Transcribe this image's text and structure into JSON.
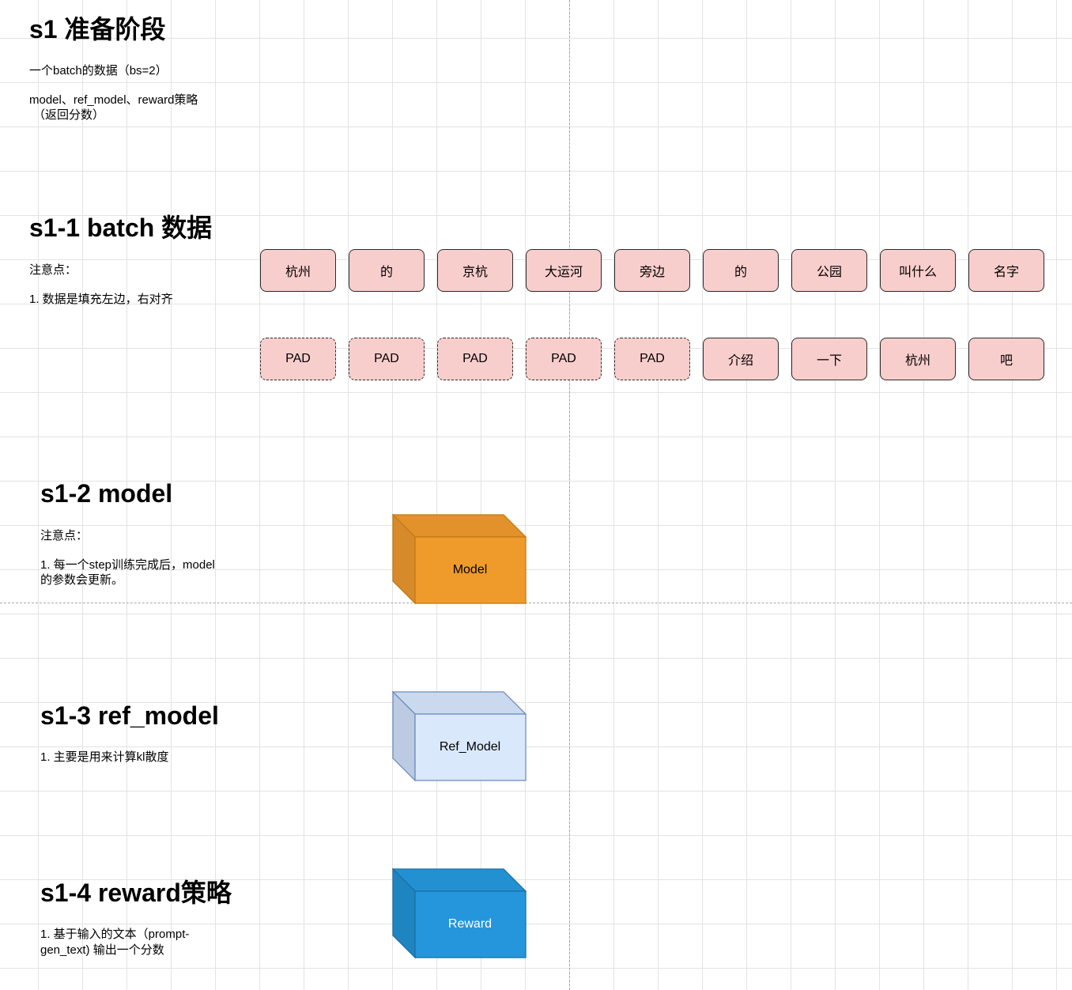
{
  "stage": {
    "title": "s1 准备阶段",
    "lines": [
      "一个batch的数据（bs=2）",
      "model、ref_model、reward策略",
      "（返回分数）"
    ]
  },
  "batch": {
    "title": "s1-1 batch 数据",
    "note_head": "注意点：",
    "note_1": "1. 数据是填充左边，右对齐",
    "row1": [
      "杭州",
      "的",
      "京杭",
      "大运河",
      "旁边",
      "的",
      "公园",
      "叫什么",
      "名字"
    ],
    "row2": [
      "PAD",
      "PAD",
      "PAD",
      "PAD",
      "PAD",
      "介绍",
      "一下",
      "杭州",
      "吧"
    ],
    "token_fill": "#f8cecc"
  },
  "model": {
    "title": "s1-2 model",
    "note_head": "注意点：",
    "note_line1": "1. 每一个step训练完成后，model",
    "note_line2": "的参数会更新。",
    "box_label": "Model",
    "colors": {
      "front": "#ef9b2c",
      "top": "#e2912b",
      "side": "#d68a2a",
      "stroke": "#c47a17",
      "text": "#000000"
    }
  },
  "ref_model": {
    "title": "s1-3 ref_model",
    "note_1": "1. 主要是用来计算kl散度",
    "box_label": "Ref_Model",
    "colors": {
      "front": "#dae8fc",
      "top": "#cbd9ef",
      "side": "#bccbe2",
      "stroke": "#6c8ebf",
      "text": "#000000"
    }
  },
  "reward": {
    "title": "s1-4 reward策略",
    "note_line1": "1. 基于输入的文本（prompt-",
    "note_line2": "gen_text) 输出一个分数",
    "box_label": "Reward",
    "colors": {
      "front": "#2596dc",
      "top": "#2390d1",
      "side": "#1f85c1",
      "stroke": "#1c6fa6",
      "text": "#ffffff"
    }
  }
}
